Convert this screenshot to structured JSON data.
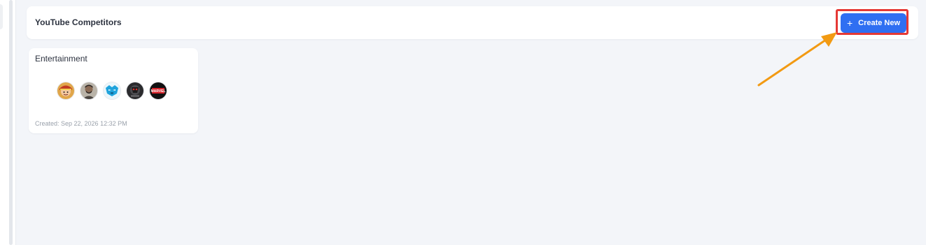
{
  "header": {
    "title": "YouTube Competitors",
    "create_button_label": "Create New",
    "create_button_icon": "plus-icon"
  },
  "groups": [
    {
      "name": "Entertainment",
      "created": "Created: Sep 22, 2026 12:32 PM",
      "channels": [
        {
          "icon": "channel-avatar-cartoon"
        },
        {
          "icon": "channel-avatar-person"
        },
        {
          "icon": "channel-avatar-beast-logo"
        },
        {
          "icon": "channel-avatar-dark-logo"
        },
        {
          "icon": "channel-avatar-marvel-logo",
          "logo_text": "MARVEL"
        }
      ]
    }
  ],
  "colors": {
    "page_background": "#f3f5f9",
    "card_background": "#ffffff",
    "primary_button": "#2f6ff2",
    "highlight_box": "#e53935",
    "annotation_arrow": "#f29a13",
    "title_text": "#2d3340",
    "muted_text": "#9aa1ab"
  }
}
